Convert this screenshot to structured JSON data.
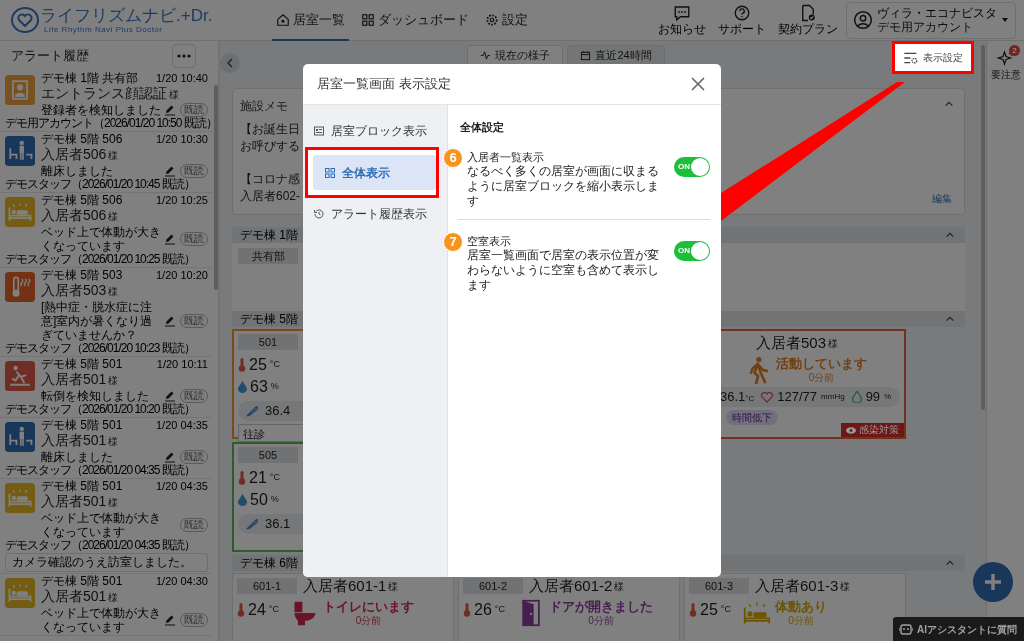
{
  "header": {
    "logo": {
      "title": "ライフリズムナビ.+Dr.",
      "subtitle": "Life Rhythm Navi Plus Doctor"
    },
    "nav": [
      {
        "kind": "home",
        "label": "居室一覧",
        "selected": true
      },
      {
        "kind": "grid",
        "label": "ダッシュボード",
        "selected": false
      },
      {
        "kind": "gear",
        "label": "設定",
        "selected": false
      }
    ],
    "tools": [
      {
        "kind": "message",
        "label": "お知らせ"
      },
      {
        "kind": "help",
        "label": "サポート"
      },
      {
        "kind": "plan",
        "label": "契約プラン"
      }
    ],
    "account": {
      "facility": "ヴィラ・エコナビスタ",
      "name": "デモ用アカウント"
    }
  },
  "alert_history": {
    "title": "アラート履歴",
    "items": [
      {
        "kind": "face",
        "color": "#78511e",
        "location": "デモ棟 1階 共有部",
        "time": "1/20 10:40",
        "name": "エントランス顔認証",
        "honorific": "様",
        "message": "登録者を検知しました",
        "editable": true,
        "read_label": "既読",
        "footer": "デモ用アカウント（2026/01/20 10:50 既読）"
      },
      {
        "kind": "bed-leave",
        "color": "#18375b",
        "location": "デモ棟 5階 506",
        "time": "1/20 10:30",
        "name": "入居者506",
        "honorific": "様",
        "message": "離床しました",
        "editable": true,
        "read_label": "既読",
        "footer": "デモスタッフ（2026/01/20 10:45 既読）"
      },
      {
        "kind": "bed-motion",
        "color": "#745c12",
        "location": "デモ棟 5階 506",
        "time": "1/20 10:25",
        "name": "入居者506",
        "honorific": "様",
        "message": "ベッド上で体動が大きくなっています",
        "editable": true,
        "read_label": "既読",
        "footer": "デモスタッフ（2026/01/20 10:25 既読）"
      },
      {
        "kind": "heat",
        "color": "#743215",
        "location": "デモ棟 5階 503",
        "time": "1/20 10:20",
        "name": "入居者503",
        "honorific": "様",
        "message": "[熱中症・脱水症に注意]室内が暑くなり過ぎていませんか？",
        "editable": true,
        "read_label": "既読",
        "footer": "デモスタッフ（2026/01/20 10:23 既読）"
      },
      {
        "kind": "fall",
        "color": "#702d24",
        "location": "デモ棟 5階 501",
        "time": "1/20 10:11",
        "name": "入居者501",
        "honorific": "様",
        "message": "転倒を検知しました",
        "editable": true,
        "read_label": "既読",
        "footer": "デモスタッフ（2026/01/20 10:20 既読）"
      },
      {
        "kind": "bed-leave",
        "color": "#18375b",
        "location": "デモ棟 5階 501",
        "time": "1/20 04:35",
        "name": "入居者501",
        "honorific": "様",
        "message": "離床しました",
        "editable": true,
        "read_label": "既読",
        "footer": "デモスタッフ（2026/01/20 04:35 既読）"
      },
      {
        "kind": "bed-motion",
        "color": "#745c12",
        "location": "デモ棟 5階 501",
        "time": "1/20 04:35",
        "name": "入居者501",
        "honorific": "様",
        "message": "ベッド上で体動が大きくなっています",
        "editable": false,
        "read_label": "既読",
        "footer": "デモスタッフ（2026/01/20 04:35 既読）",
        "comment": "カメラ確認のうえ訪室しました。"
      },
      {
        "kind": "bed-motion",
        "color": "#745c12",
        "location": "デモ棟 5階 501",
        "time": "1/20 04:30",
        "name": "入居者501",
        "honorific": "様",
        "message": "ベッド上で体動が大きくなっています",
        "editable": true,
        "read_label": "既読"
      }
    ]
  },
  "main": {
    "tabs": [
      {
        "kind": "activity",
        "label": "現在の様子",
        "selected": true
      },
      {
        "kind": "calendar",
        "label": "直近24時間",
        "selected": false
      }
    ],
    "display_settings": {
      "label": "表示設定",
      "highlighted": true
    },
    "memo": {
      "title": "施設メモ",
      "paragraphs": [
        [
          "【お誕生日",
          "お呼びする"
        ],
        [
          "【コロナ感",
          "入居者602-"
        ]
      ],
      "edit_label": "編集"
    },
    "floors": [
      {
        "name": "デモ棟 1階",
        "rows": [
          [
            {
              "kind": "common",
              "room": "共有部"
            }
          ]
        ]
      },
      {
        "name": "デモ棟 5階",
        "rows": [
          [
            {
              "kind": "resident",
              "room": "501",
              "color": "#784b17",
              "temperature": "25",
              "temperature_unit": "°C",
              "humidity": "63",
              "humidity_unit": "%",
              "body_temp": "36.4",
              "note": "往診"
            },
            null,
            {
              "kind": "resident",
              "color": "#74301e",
              "name": "入居者503",
              "honorific": "様",
              "status": {
                "kind": "walking",
                "text": "活動しています",
                "ago": "0分前",
                "color": "#733f11"
              },
              "body_temp": "36.1",
              "body_temp_unit": "°C",
              "blood_pressure": "127/77",
              "blood_pressure_unit": "mmHg",
              "spo2": "99",
              "spo2_unit": "%",
              "tag": "時間低下",
              "alert_label": "感染対策"
            }
          ],
          [
            {
              "kind": "resident",
              "room": "505",
              "color": "#2e5c2e",
              "temperature": "21",
              "temperature_unit": "°C",
              "humidity": "50",
              "humidity_unit": "%",
              "body_temp": "36.1"
            }
          ]
        ]
      },
      {
        "name": "デモ棟 6階",
        "rows": [
          [
            {
              "kind": "resident",
              "room": "601-1",
              "name": "入居者601-1",
              "honorific": "様",
              "temperature": "24",
              "temperature_unit": "°C",
              "status": {
                "kind": "toilet",
                "text": "トイレにいます",
                "ago": "0分前",
                "color": "#6b1427"
              }
            },
            {
              "kind": "resident",
              "room": "601-2",
              "name": "入居者601-2",
              "honorific": "様",
              "temperature": "26",
              "temperature_unit": "°C",
              "status": {
                "kind": "door",
                "text": "ドアが開きました",
                "ago": "0分前",
                "color": "#471f4f"
              }
            },
            {
              "kind": "resident",
              "room": "601-3",
              "name": "入居者601-3",
              "honorific": "様",
              "temperature": "25",
              "temperature_unit": "°C",
              "status": {
                "kind": "bed-motion",
                "text": "体動あり",
                "ago": "0分前",
                "color": "#6d5400"
              }
            }
          ]
        ]
      }
    ]
  },
  "right_rail": {
    "label": "要注意",
    "badge": "2"
  },
  "ai_button": {
    "label": "AIアシスタントに質問"
  },
  "modal": {
    "title": "居室一覧画面 表示設定",
    "nav": [
      {
        "kind": "block",
        "label": "居室ブロック表示",
        "selected": false,
        "highlighted": false
      },
      {
        "kind": "grid",
        "label": "全体表示",
        "selected": true,
        "highlighted": true
      },
      {
        "kind": "history",
        "label": "アラート履歴表示",
        "selected": false,
        "highlighted": false
      }
    ],
    "section_title": "全体設定",
    "settings": [
      {
        "step": "6",
        "title": "入居者一覧表示",
        "description": "なるべく多くの居室が画面に収まるように居室ブロックを縮小表示します",
        "on": true,
        "switch_label": "ON"
      },
      {
        "step": "7",
        "title": "空室表示",
        "description": "居室一覧画面で居室の表示位置が変わらないように空室も含めて表示します",
        "on": true,
        "switch_label": "ON"
      }
    ]
  }
}
